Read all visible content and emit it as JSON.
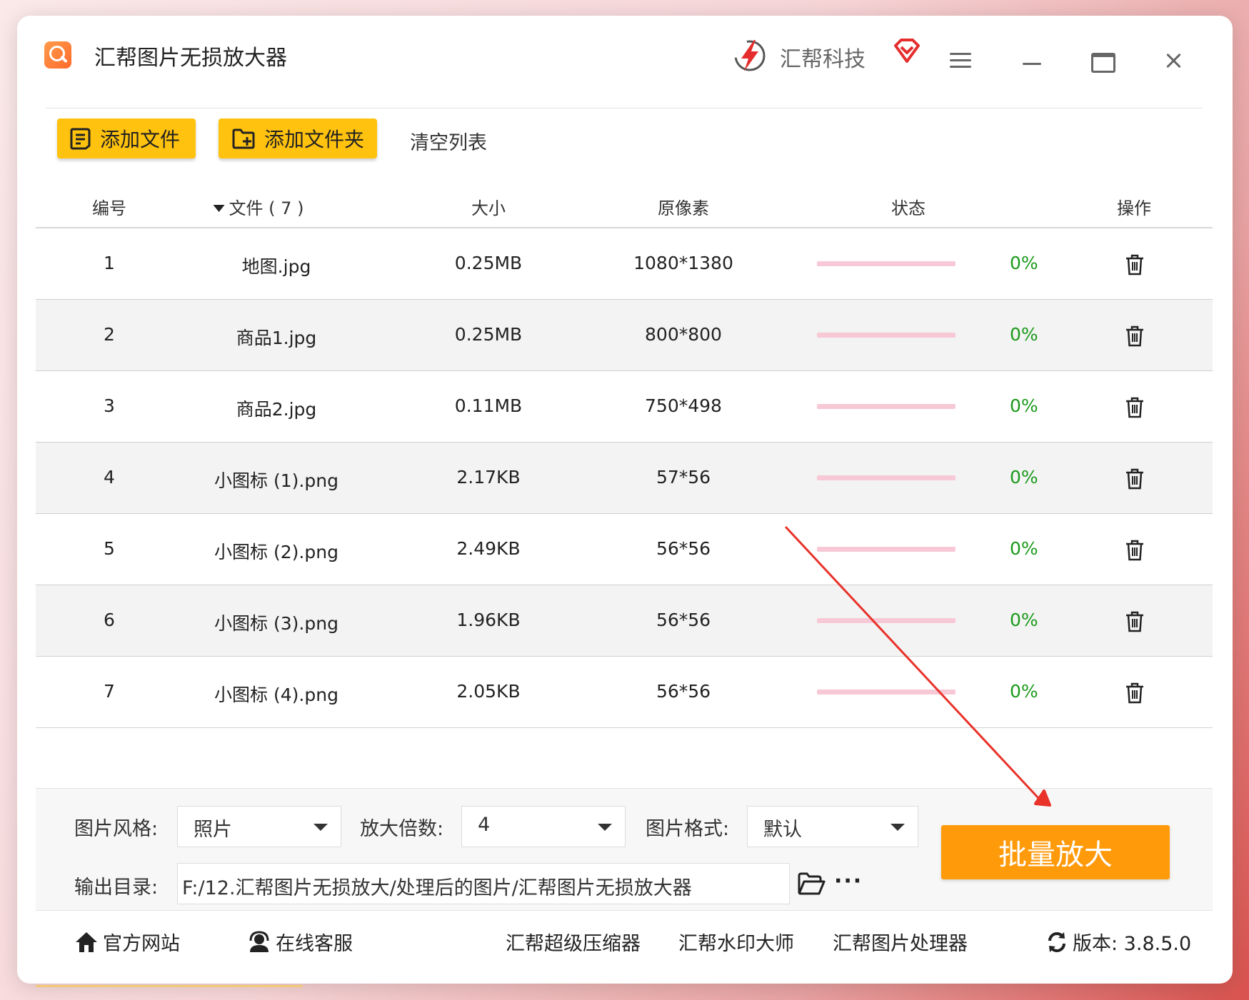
{
  "app": {
    "title": "汇帮图片无损放大器",
    "brand_name": "汇帮科技"
  },
  "toolbar": {
    "add_file_label": "添加文件",
    "add_folder_label": "添加文件夹",
    "clear_list_label": "清空列表"
  },
  "table": {
    "headers": {
      "index": "编号",
      "file": "文件 ( 7 )",
      "size": "大小",
      "pixels": "原像素",
      "status": "状态",
      "action": "操作"
    },
    "rows": [
      {
        "index": "1",
        "file": "地图.jpg",
        "size": "0.25MB",
        "pixels": "1080*1380",
        "progress": "0%"
      },
      {
        "index": "2",
        "file": "商品1.jpg",
        "size": "0.25MB",
        "pixels": "800*800",
        "progress": "0%"
      },
      {
        "index": "3",
        "file": "商品2.jpg",
        "size": "0.11MB",
        "pixels": "750*498",
        "progress": "0%"
      },
      {
        "index": "4",
        "file": "小图标 (1).png",
        "size": "2.17KB",
        "pixels": "57*56",
        "progress": "0%"
      },
      {
        "index": "5",
        "file": "小图标 (2).png",
        "size": "2.49KB",
        "pixels": "56*56",
        "progress": "0%"
      },
      {
        "index": "6",
        "file": "小图标 (3).png",
        "size": "1.96KB",
        "pixels": "56*56",
        "progress": "0%"
      },
      {
        "index": "7",
        "file": "小图标 (4).png",
        "size": "2.05KB",
        "pixels": "56*56",
        "progress": "0%"
      }
    ]
  },
  "settings": {
    "style_label": "图片风格:",
    "style_value": "照片",
    "scale_label": "放大倍数:",
    "scale_value": "4",
    "format_label": "图片格式:",
    "format_value": "默认",
    "output_label": "输出目录:",
    "output_path": "F:/12.汇帮图片无损放大/处理后的图片/汇帮图片无损放大器",
    "more_label": "···"
  },
  "batch_button_label": "批量放大",
  "footer": {
    "website": "官方网站",
    "support": "在线客服",
    "compressor": "汇帮超级压缩器",
    "watermark": "汇帮水印大师",
    "image_processor": "汇帮图片处理器",
    "version": "版本:  3.8.5.0"
  },
  "colors": {
    "accent_yellow": "#ffc20e",
    "batch_orange": "#ff9a0a",
    "progress_track": "#f7c8d5",
    "percent_green": "#1a9a1a",
    "annotation_arrow": "#e8322a"
  },
  "icons": {
    "app_logo": "magnifier-app-icon",
    "brand_logo": "huibang-lightning-logo",
    "brand_gem": "heart-gem-icon",
    "menu": "hamburger-icon",
    "minimize": "minimize-icon",
    "maximize": "maximize-icon",
    "close": "close-icon",
    "add_file": "file-list-icon",
    "add_folder": "folder-plus-icon",
    "delete": "trash-icon",
    "open_folder": "folder-open-icon",
    "home": "home-icon",
    "support": "headset-icon",
    "refresh": "refresh-icon"
  }
}
